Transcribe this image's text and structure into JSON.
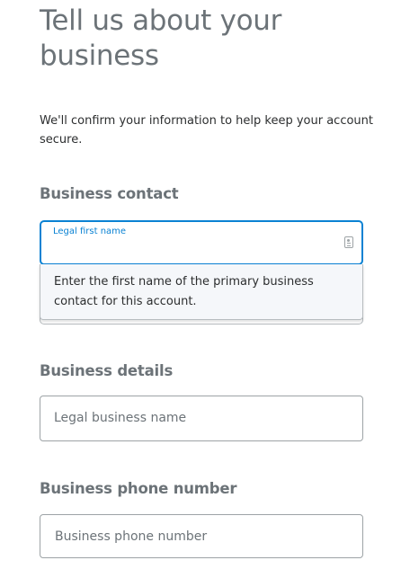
{
  "page": {
    "title": "Tell us about your business",
    "intro": "We'll confirm your information to help keep your account secure."
  },
  "sections": {
    "contact": {
      "heading": "Business contact",
      "first_name": {
        "label": "Legal first name",
        "value": "",
        "icon": "contact-card-icon",
        "helper": "Enter the first name of the primary business contact for this account."
      }
    },
    "details": {
      "heading": "Business details",
      "business_name": {
        "placeholder": "Legal business name",
        "value": ""
      }
    },
    "phone": {
      "heading": "Business phone number",
      "phone_number": {
        "placeholder": "Business phone number",
        "value": ""
      }
    }
  },
  "colors": {
    "focus_blue": "#0a82d3",
    "heading_gray": "#6c7378",
    "border_gray": "#9da3a6",
    "tooltip_bg": "#f5f7fa"
  }
}
